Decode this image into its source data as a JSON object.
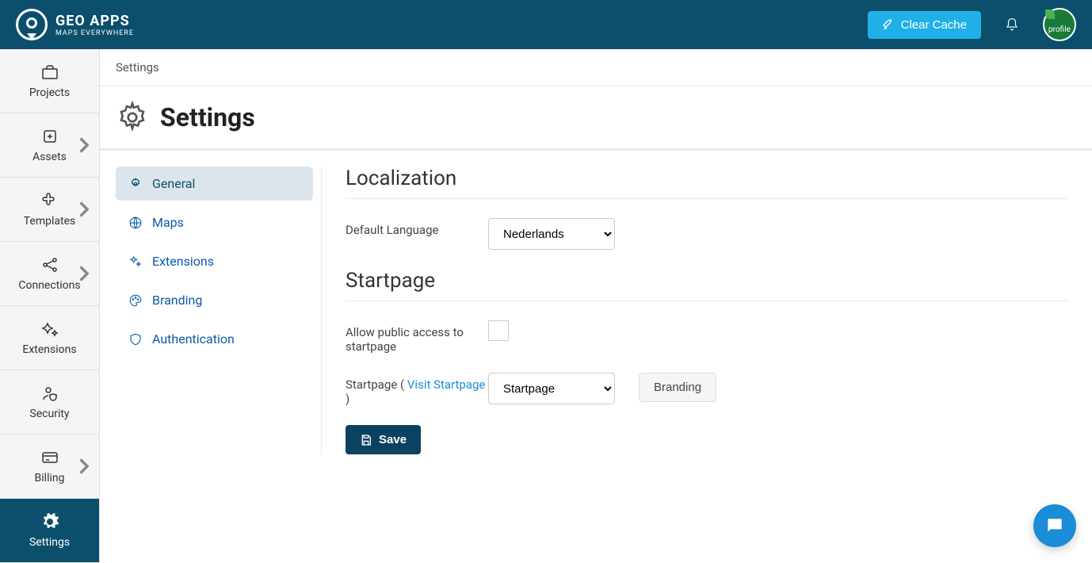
{
  "header": {
    "brand_title": "GEO APPS",
    "brand_sub": "MAPS EVERYWHERE",
    "clear_cache": "Clear Cache",
    "avatar_text": "profile"
  },
  "sidebar": {
    "items": [
      {
        "label": "Projects",
        "chev": false
      },
      {
        "label": "Assets",
        "chev": true
      },
      {
        "label": "Templates",
        "chev": true
      },
      {
        "label": "Connections",
        "chev": true
      },
      {
        "label": "Extensions",
        "chev": false
      },
      {
        "label": "Security",
        "chev": false
      },
      {
        "label": "Billing",
        "chev": true
      },
      {
        "label": "Settings",
        "chev": false
      }
    ],
    "active_index": 7
  },
  "breadcrumb": "Settings",
  "page_title": "Settings",
  "subnav": {
    "items": [
      {
        "label": "General"
      },
      {
        "label": "Maps"
      },
      {
        "label": "Extensions"
      },
      {
        "label": "Branding"
      },
      {
        "label": "Authentication"
      }
    ],
    "active_index": 0
  },
  "panel": {
    "localization_title": "Localization",
    "default_lang_label": "Default Language",
    "default_lang_value": "Nederlands",
    "startpage_title": "Startpage",
    "allow_public_label": "Allow public access to startpage",
    "allow_public_checked": false,
    "startpage_label_prefix": "Startpage ( ",
    "startpage_link": "Visit Startpage",
    "startpage_label_suffix": " )",
    "startpage_select_value": "Startpage",
    "branding_button": "Branding",
    "save_button": "Save"
  }
}
